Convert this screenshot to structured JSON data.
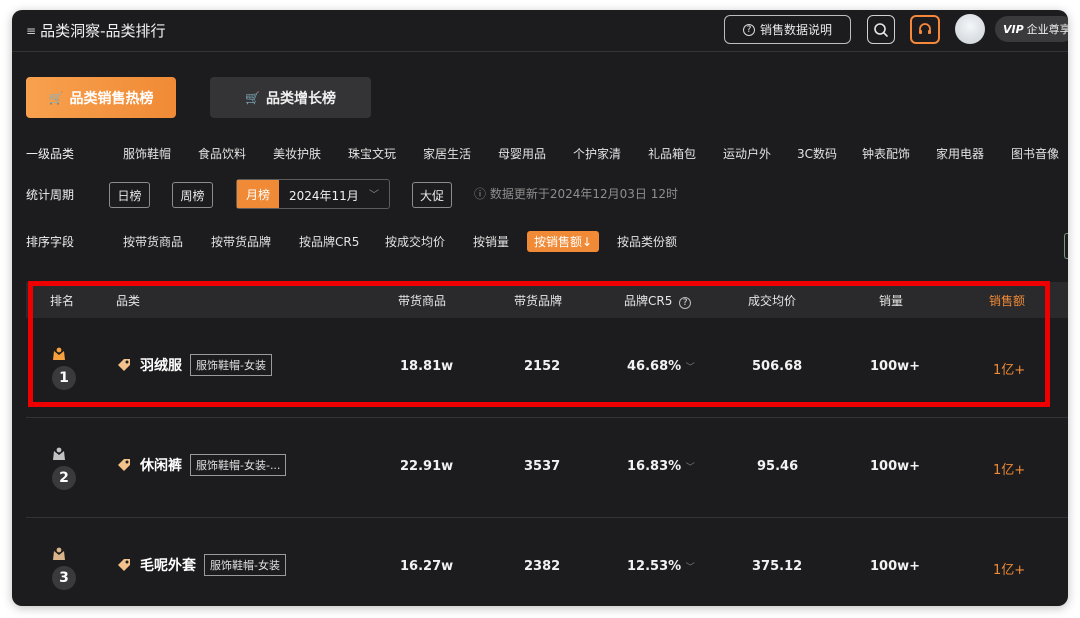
{
  "header": {
    "menu_glyph": "≡",
    "title": "品类洞察-品类排行",
    "desc_button": "销售数据说明",
    "vip_mark": "VIP",
    "vip_text": "企业尊享"
  },
  "tabs": [
    {
      "label": "品类销售热榜",
      "active": true
    },
    {
      "label": "品类增长榜",
      "active": false
    }
  ],
  "filters": {
    "category": {
      "label": "一级品类",
      "items": [
        "服饰鞋帽",
        "食品饮料",
        "美妆护肤",
        "珠宝文玩",
        "家居生活",
        "母婴用品",
        "个护家清",
        "礼品箱包",
        "运动户外",
        "3C数码",
        "钟表配饰",
        "家用电器",
        "图书音像"
      ]
    },
    "period": {
      "label": "统计周期",
      "day": "日榜",
      "week": "周榜",
      "month": "月榜",
      "month_value": "2024年11月",
      "promo": "大促",
      "update_note": "数据更新于2024年12月03日 12时"
    },
    "sort": {
      "label": "排序字段",
      "items": [
        "按带货商品",
        "按带货品牌",
        "按品牌CR5",
        "按成交均价",
        "按销量",
        "按销售额↓",
        "按品类份额"
      ],
      "active_index": 5
    }
  },
  "table": {
    "headers": [
      "排名",
      "品类",
      "带货商品",
      "带货品牌",
      "品牌CR5",
      "成交均价",
      "销量",
      "销售额"
    ],
    "rows": [
      {
        "rank": "1",
        "name": "羽绒服",
        "badge": "服饰鞋帽-女装",
        "goods": "18.81w",
        "brands": "2152",
        "cr5": "46.68%",
        "price": "506.68",
        "volume": "100w+",
        "sales": "1亿+"
      },
      {
        "rank": "2",
        "name": "休闲裤",
        "badge": "服饰鞋帽-女装-...",
        "goods": "22.91w",
        "brands": "3537",
        "cr5": "16.83%",
        "price": "95.46",
        "volume": "100w+",
        "sales": "1亿+"
      },
      {
        "rank": "3",
        "name": "毛呢外套",
        "badge": "服饰鞋帽-女装",
        "goods": "16.27w",
        "brands": "2382",
        "cr5": "12.53%",
        "price": "375.12",
        "volume": "100w+",
        "sales": "1亿+"
      }
    ]
  },
  "colors": {
    "accent": "#f08a36",
    "highlight": "#ef0000",
    "background": "#1c1c1e"
  }
}
